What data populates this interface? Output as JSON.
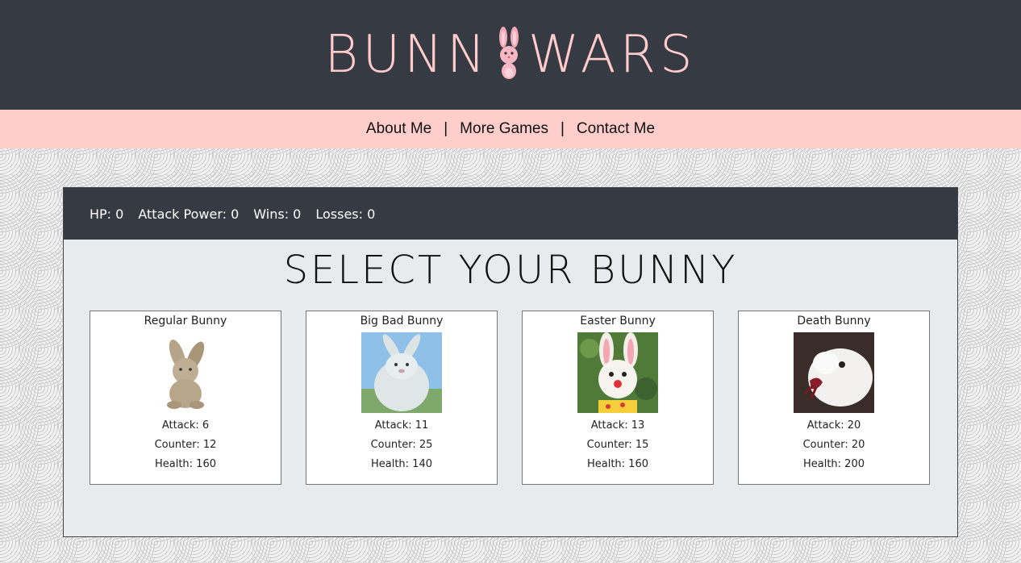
{
  "header": {
    "title_part1": "BUNN",
    "title_part2": "WARS",
    "logo_icon": "bunny-logo-icon"
  },
  "nav": {
    "items": [
      "About Me",
      "More Games",
      "Contact Me"
    ],
    "separator": "|"
  },
  "stats": {
    "hp_label": "HP:",
    "hp": "0",
    "attack_label": "Attack Power:",
    "attack": "0",
    "wins_label": "Wins:",
    "wins": "0",
    "losses_label": "Losses:",
    "losses": "0"
  },
  "title": "SELECT YOUR BUNNY",
  "cards": [
    {
      "name": "Regular Bunny",
      "attack": "Attack: 6",
      "counter": "Counter: 12",
      "health": "Health: 160"
    },
    {
      "name": "Big Bad Bunny",
      "attack": "Attack: 11",
      "counter": "Counter: 25",
      "health": "Health: 140"
    },
    {
      "name": "Easter Bunny",
      "attack": "Attack: 13",
      "counter": "Counter: 15",
      "health": "Health: 160"
    },
    {
      "name": "Death Bunny",
      "attack": "Attack: 20",
      "counter": "Counter: 20",
      "health": "Health: 200"
    }
  ],
  "colors": {
    "header_bg": "#363a42",
    "accent_pink": "#ffcecb",
    "panel_bg": "#e8ebee"
  }
}
